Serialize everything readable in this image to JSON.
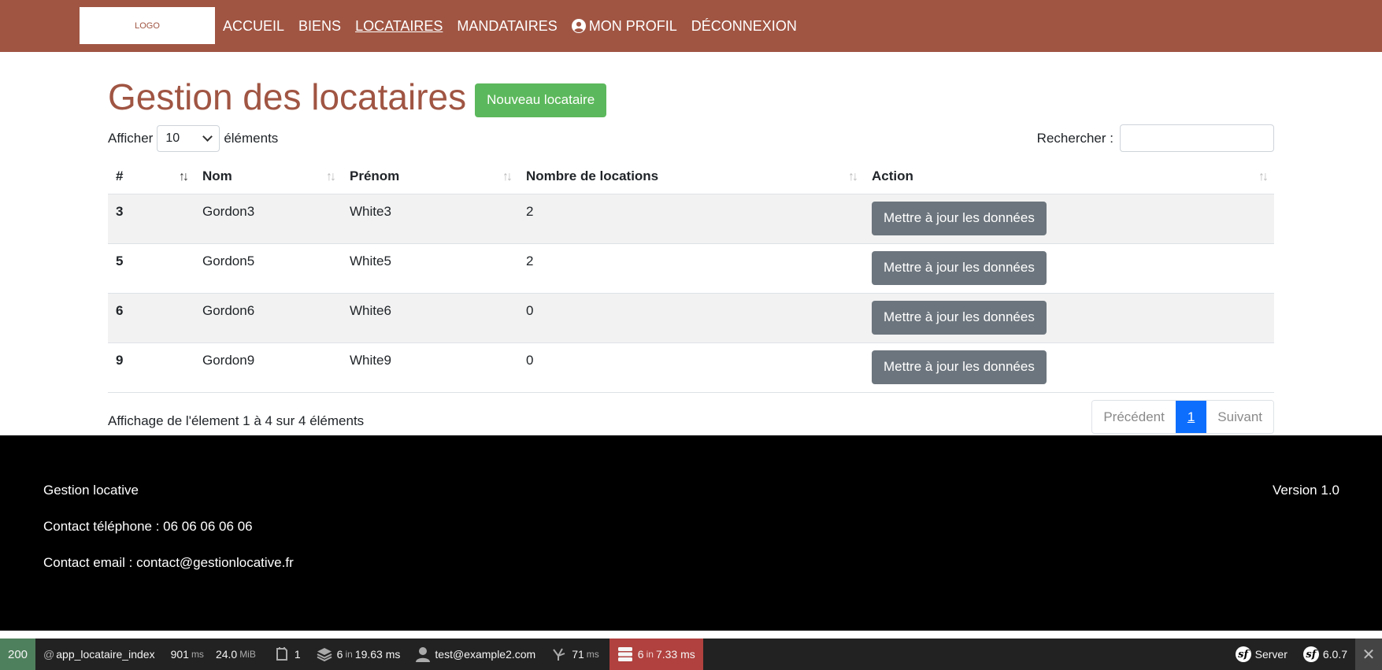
{
  "navbar": {
    "logo": "LOGO",
    "links": [
      {
        "label": "ACCUEIL",
        "active": false
      },
      {
        "label": "BIENS",
        "active": false
      },
      {
        "label": "LOCATAIRES",
        "active": true
      },
      {
        "label": "MANDATAIRES",
        "active": false
      },
      {
        "label": "MON PROFIL",
        "active": false,
        "icon": "user-circle-icon"
      },
      {
        "label": "DÉCONNEXION",
        "active": false
      }
    ]
  },
  "page": {
    "title": "Gestion des locataires",
    "new_button": "Nouveau locataire"
  },
  "length_menu": {
    "prefix": "Afficher",
    "value": "10",
    "suffix": "éléments"
  },
  "search": {
    "label": "Rechercher :",
    "value": ""
  },
  "table": {
    "columns": [
      "#",
      "Nom",
      "Prénom",
      "Nombre de locations",
      "Action"
    ],
    "rows": [
      {
        "id": "3",
        "nom": "Gordon3",
        "prenom": "White3",
        "locations": "2",
        "action": "Mettre à jour les données"
      },
      {
        "id": "5",
        "nom": "Gordon5",
        "prenom": "White5",
        "locations": "2",
        "action": "Mettre à jour les données"
      },
      {
        "id": "6",
        "nom": "Gordon6",
        "prenom": "White6",
        "locations": "0",
        "action": "Mettre à jour les données"
      },
      {
        "id": "9",
        "nom": "Gordon9",
        "prenom": "White9",
        "locations": "0",
        "action": "Mettre à jour les données"
      }
    ]
  },
  "info": "Affichage de l'élement 1 à 4 sur 4 éléments",
  "pagination": {
    "previous": "Précédent",
    "current": "1",
    "next": "Suivant"
  },
  "footer": {
    "name": "Gestion locative",
    "phone": "Contact téléphone : 06 06 06 06 06",
    "email": "Contact email : contact@gestionlocative.fr",
    "version": "Version 1.0"
  },
  "debug_toolbar": {
    "status": "200",
    "route": "app_locataire_index",
    "time_value": "901",
    "time_unit": "ms",
    "memory_value": "24.0",
    "memory_unit": "MiB",
    "forms": "1",
    "cache_count": "6",
    "cache_in": "in",
    "cache_time": "19.63 ms",
    "user": "test@example2.com",
    "events_value": "71",
    "events_unit": "ms",
    "db_count": "6",
    "db_in": "in",
    "db_time": "7.33 ms",
    "server": "Server",
    "symfony_version": "6.0.7",
    "colors": {
      "status": "#4f805d",
      "db": "#b0413e"
    }
  },
  "colors": {
    "brand": "#a05543",
    "success": "#5cb85c",
    "secondary": "#6c757d",
    "primary": "#0d6efd"
  }
}
